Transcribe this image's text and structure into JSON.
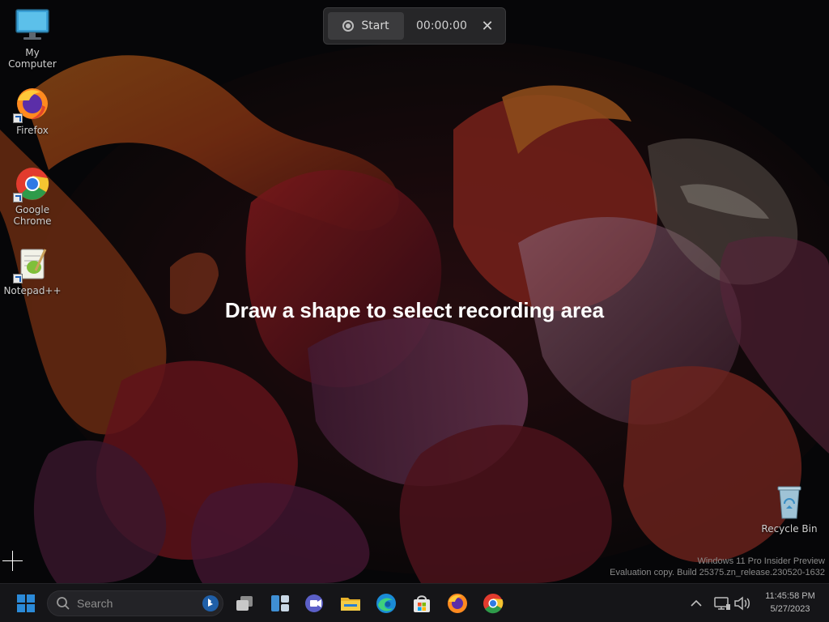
{
  "desktop": {
    "icons": [
      {
        "label": "My Computer",
        "icon": "monitor-icon"
      },
      {
        "label": "Firefox",
        "icon": "firefox-icon"
      },
      {
        "label": "Google Chrome",
        "icon": "chrome-icon"
      },
      {
        "label": "Notepad++",
        "icon": "notepadpp-icon"
      },
      {
        "label": "Recycle Bin",
        "icon": "recycle-bin-icon"
      }
    ]
  },
  "recording_toolbar": {
    "start_label": "Start",
    "timer": "00:00:00",
    "close_glyph": "✕"
  },
  "instruction": "Draw a shape to select recording area",
  "watermark": {
    "line1": "Windows 11 Pro Insider Preview",
    "line2": "Evaluation copy. Build 25375.zn_release.230520-1632"
  },
  "taskbar": {
    "search_placeholder": "Search",
    "pinned": [
      "start-icon",
      "task-view-icon",
      "widgets-icon",
      "teams-chat-icon",
      "file-explorer-icon",
      "edge-icon",
      "store-icon",
      "firefox-icon",
      "chrome-icon"
    ],
    "clock": {
      "time": "11:45:58 PM",
      "date": "5/27/2023"
    }
  },
  "colors": {
    "accent": "#0078d4",
    "toolbar_bg": "#262628",
    "taskbar_bg": "#151518"
  }
}
